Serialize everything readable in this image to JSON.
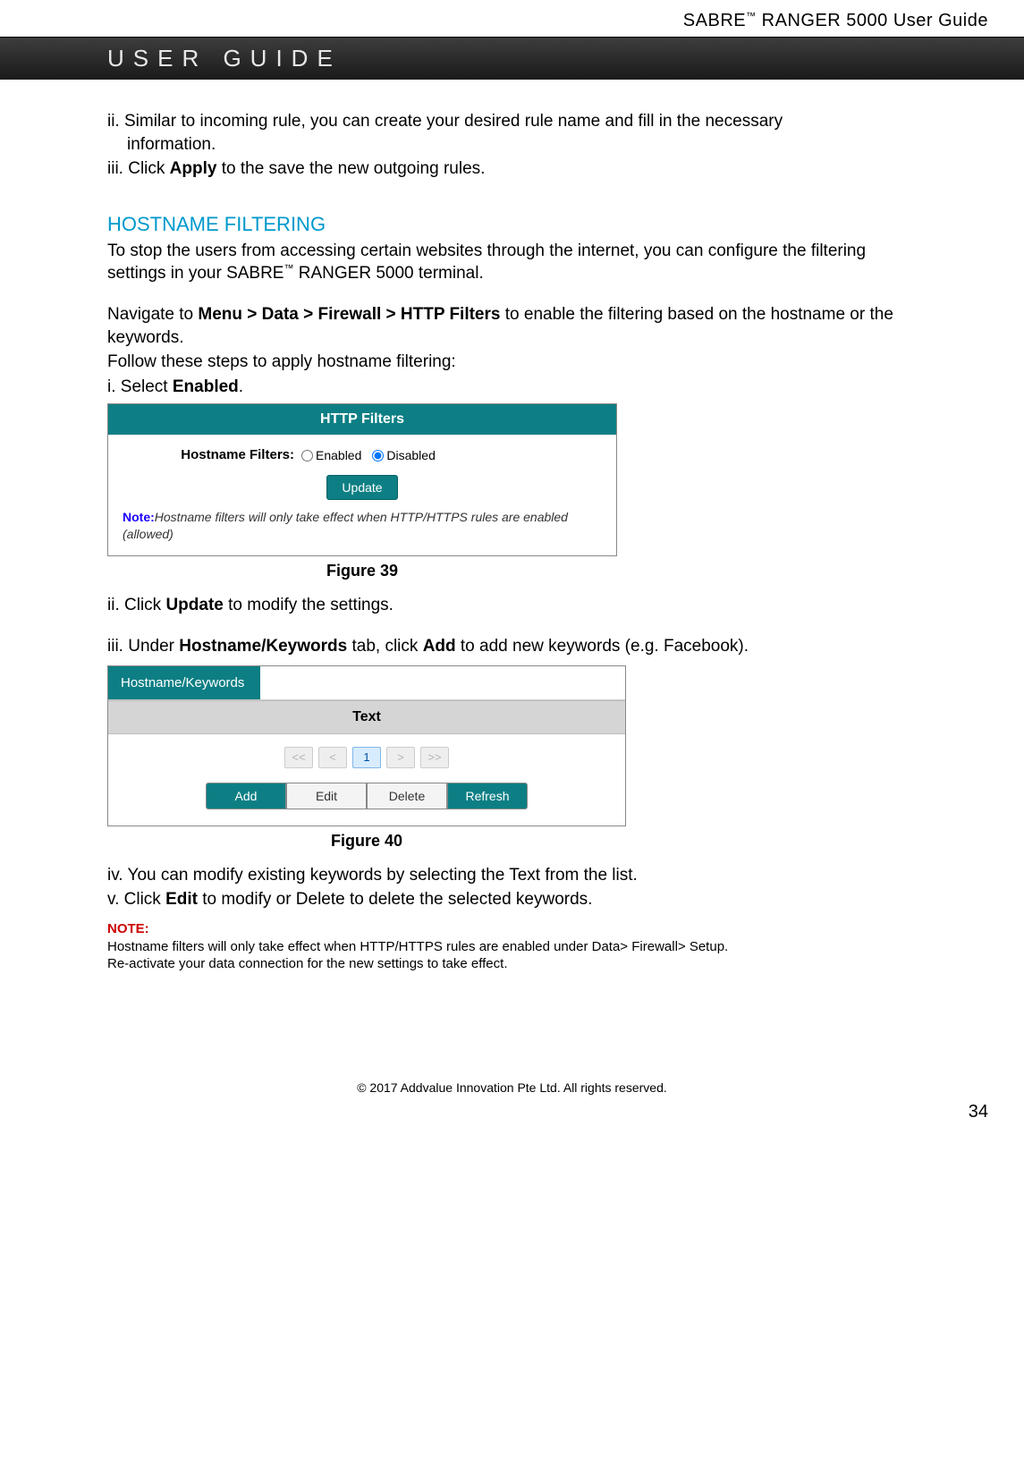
{
  "header": {
    "product": "SABRE",
    "tm": "™",
    "model": " RANGER 5000 User Guide"
  },
  "banner": "USER GUIDE",
  "body": {
    "step_ii_a": "ii. Similar to incoming rule, you can create your desired rule name and fill in the necessary",
    "step_ii_b": "information.",
    "step_iii_pre": "iii. Click ",
    "step_iii_bold": "Apply",
    "step_iii_post": " to the save the new outgoing rules.",
    "section_title": "HOSTNAME FILTERING",
    "section_p1_a": "To stop the users from accessing certain websites through the internet, you can configure the filtering settings in your SABRE",
    "section_p1_tm": "™",
    "section_p1_b": " RANGER 5000 terminal.",
    "section_p2_pre": "Navigate to ",
    "section_p2_bold": "Menu > Data > Firewall > HTTP Filters",
    "section_p2_post": " to enable the filtering based on the hostname or the keywords.",
    "section_p3": "Follow these steps to apply hostname filtering:",
    "section_p4_pre": "i. Select ",
    "section_p4_bold": "Enabled",
    "section_p4_post": "."
  },
  "fig39": {
    "title": "HTTP Filters",
    "label": "Hostname Filters:",
    "opt_enabled": "Enabled",
    "opt_disabled": "Disabled",
    "update": "Update",
    "note_label": "Note:",
    "note_text": "Hostname filters will only take effect when HTTP/HTTPS rules are enabled (allowed)",
    "caption": "Figure 39"
  },
  "mid": {
    "step_ii_pre": "ii. Click ",
    "step_ii_bold": "Update",
    "step_ii_post": " to modify the settings.",
    "step_iii_pre": "iii. Under ",
    "step_iii_b1": "Hostname/Keywords",
    "step_iii_mid": " tab, click ",
    "step_iii_b2": "Add",
    "step_iii_post": " to add new keywords (e.g. Facebook)."
  },
  "fig40": {
    "tab": "Hostname/Keywords",
    "thead": "Text",
    "pager_first": "<<",
    "pager_prev": "<",
    "pager_1": "1",
    "pager_next": ">",
    "pager_last": ">>",
    "btn_add": "Add",
    "btn_edit": "Edit",
    "btn_delete": "Delete",
    "btn_refresh": "Refresh",
    "caption": "Figure 40"
  },
  "after": {
    "step_iv": "iv. You can modify existing keywords by selecting the Text from the list.",
    "step_v_pre": "v. Click ",
    "step_v_bold": "Edit",
    "step_v_post": " to modify or Delete to delete the selected keywords.",
    "note_label": "NOTE:",
    "note_l1": "Hostname filters will only take effect when HTTP/HTTPS rules are enabled under Data> Firewall> Setup.",
    "note_l2": "Re-activate your data connection for the new settings to take effect."
  },
  "footer": {
    "copyright": "© 2017 Addvalue Innovation Pte Ltd. All rights reserved.",
    "pagenum": "34"
  }
}
